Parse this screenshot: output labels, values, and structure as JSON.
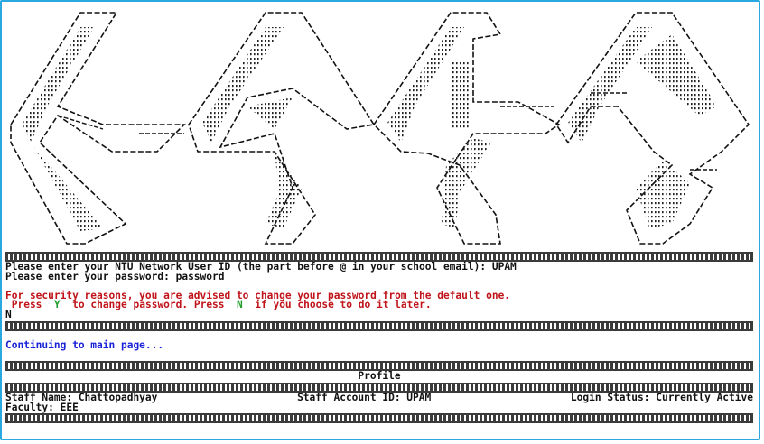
{
  "terminal": {
    "banner_text": "NTU",
    "prompts": {
      "user_id_label": "Please enter your NTU Network User ID (the part before @ in your school email): ",
      "user_id_value": "UPAM",
      "password_label": "Please enter your password: ",
      "password_value": "password"
    },
    "security_notice": "For security reasons, you are advised to change your password from the default one.",
    "choice": {
      "press1": " Press ",
      "key_y": "Y",
      "mid": " to change password. Press ",
      "key_n": "N",
      "tail": " if you choose to do it later."
    },
    "user_input": "N",
    "continuing": "Continuing to main page...",
    "profile": {
      "title": "Profile",
      "staff_name": "Staff Name: Chattopadhyay",
      "account_id": "Staff Account ID: UPAM",
      "login_status": "Login Status: Currently Active",
      "faculty": "Faculty: EEE"
    },
    "colors": {
      "text": "#111111",
      "warning": "#c0141a",
      "key_y": "#1f9e2a",
      "key_n": "#1f9e2a",
      "info": "#1a22d8",
      "frame_border": "#29a9e0"
    }
  }
}
